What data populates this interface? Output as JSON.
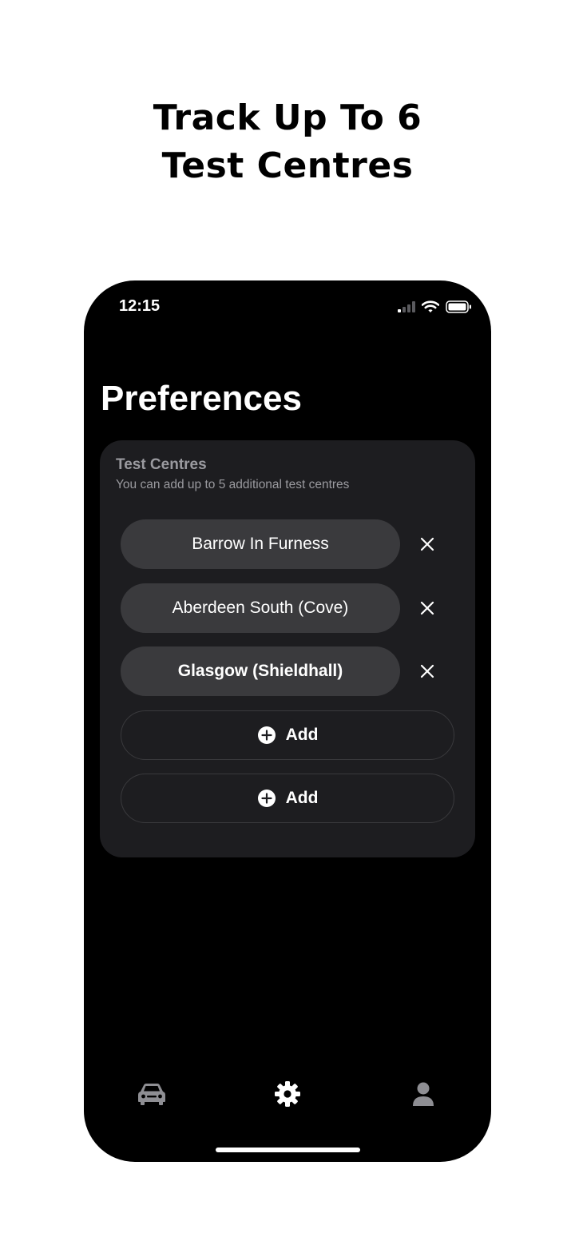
{
  "headline": {
    "line1": "Track Up To 6",
    "line2": "Test Centres"
  },
  "status_bar": {
    "time": "12:15",
    "icons": [
      "cellular-signal-icon",
      "wifi-icon",
      "battery-icon"
    ]
  },
  "page": {
    "title": "Preferences"
  },
  "card": {
    "title": "Test Centres",
    "subtitle": "You can add up to 5 additional test centres",
    "centres": [
      {
        "name": "Barrow In Furness",
        "remove_icon": "close-icon"
      },
      {
        "name": "Aberdeen South (Cove)",
        "remove_icon": "close-icon"
      },
      {
        "name": "Glasgow (Shieldhall)",
        "remove_icon": "close-icon"
      }
    ],
    "add_buttons": [
      {
        "label": "Add",
        "icon": "plus-circle-icon"
      },
      {
        "label": "Add",
        "icon": "plus-circle-icon"
      }
    ]
  },
  "tab_bar": {
    "tabs": [
      {
        "icon": "car-icon",
        "active": false
      },
      {
        "icon": "gear-icon",
        "active": true
      },
      {
        "icon": "person-icon",
        "active": false
      }
    ]
  },
  "colors": {
    "background": "#ffffff",
    "phone_background": "#000000",
    "card_background": "#1d1d20",
    "pill_background": "#3a3a3d",
    "muted_text": "#9a9a9f",
    "tab_inactive": "#8e8e93",
    "tab_active": "#ffffff"
  }
}
